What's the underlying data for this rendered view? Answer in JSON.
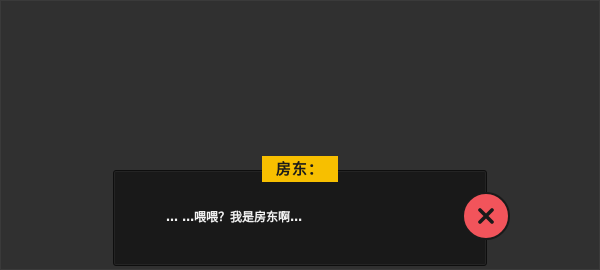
{
  "dialog": {
    "speaker": "房东：",
    "line": "… …喂喂？我是房东啊…"
  },
  "close_button": {
    "icon": "close-icon"
  },
  "colors": {
    "background": "#303030",
    "panel": "#191919",
    "speaker_tag": "#f7bf00",
    "close_button": "#f2545b",
    "text": "#f2f2f2"
  }
}
